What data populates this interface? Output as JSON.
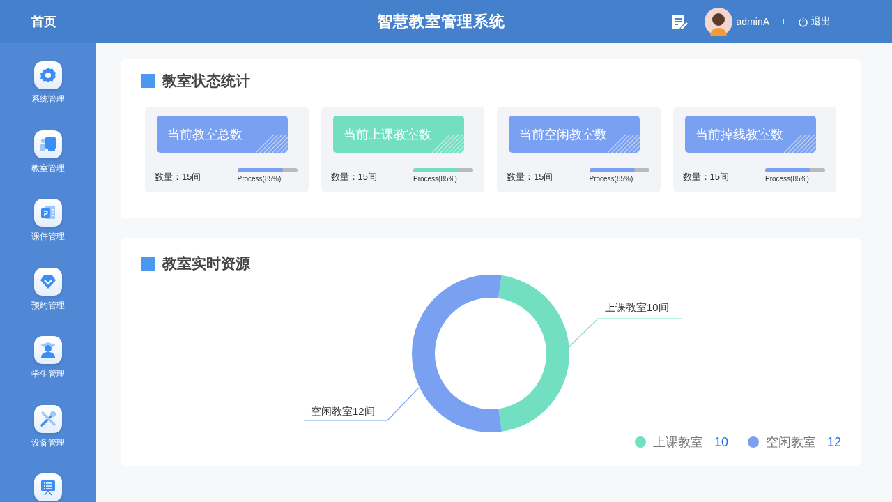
{
  "header": {
    "home": "首页",
    "title": "智慧教室管理系统",
    "user": "adminA",
    "logout": "退出"
  },
  "sidebar": {
    "items": [
      {
        "label": "系统管理"
      },
      {
        "label": "教室管理"
      },
      {
        "label": "课件管理"
      },
      {
        "label": "预约管理"
      },
      {
        "label": "学生管理"
      },
      {
        "label": "设备管理"
      }
    ]
  },
  "stats_panel": {
    "title": "教室状态统计",
    "cards": [
      {
        "title": "当前教室总数",
        "count": "数量：15间",
        "progress_label": "Process(85%)",
        "level": 0.76,
        "color": "#7aa0f2"
      },
      {
        "title": "当前上课教室数",
        "count": "数量：15间",
        "progress_label": "Process(85%)",
        "level": 0.76,
        "color": "#72dfc3"
      },
      {
        "title": "当前空闲教室数",
        "count": "数量：15间",
        "progress_label": "Process(85%)",
        "level": 0.76,
        "color": "#7aa0f2"
      },
      {
        "title": "当前掉线教室数",
        "count": "数量：15间",
        "progress_label": "Process(85%)",
        "level": 0.76,
        "color": "#7aa0f2"
      }
    ]
  },
  "resources_panel": {
    "title": "教室实时资源",
    "chart_data": {
      "type": "donut",
      "values": [
        45.5,
        54.5
      ],
      "annotations": [
        "上课教室10间",
        "空闲教室12间"
      ]
    },
    "legend": [
      {
        "label": "上课教室",
        "value": "10",
        "color": "#72dfc3"
      },
      {
        "label": "空闲教室",
        "value": "12",
        "color": "#7aa0f2"
      }
    ]
  }
}
